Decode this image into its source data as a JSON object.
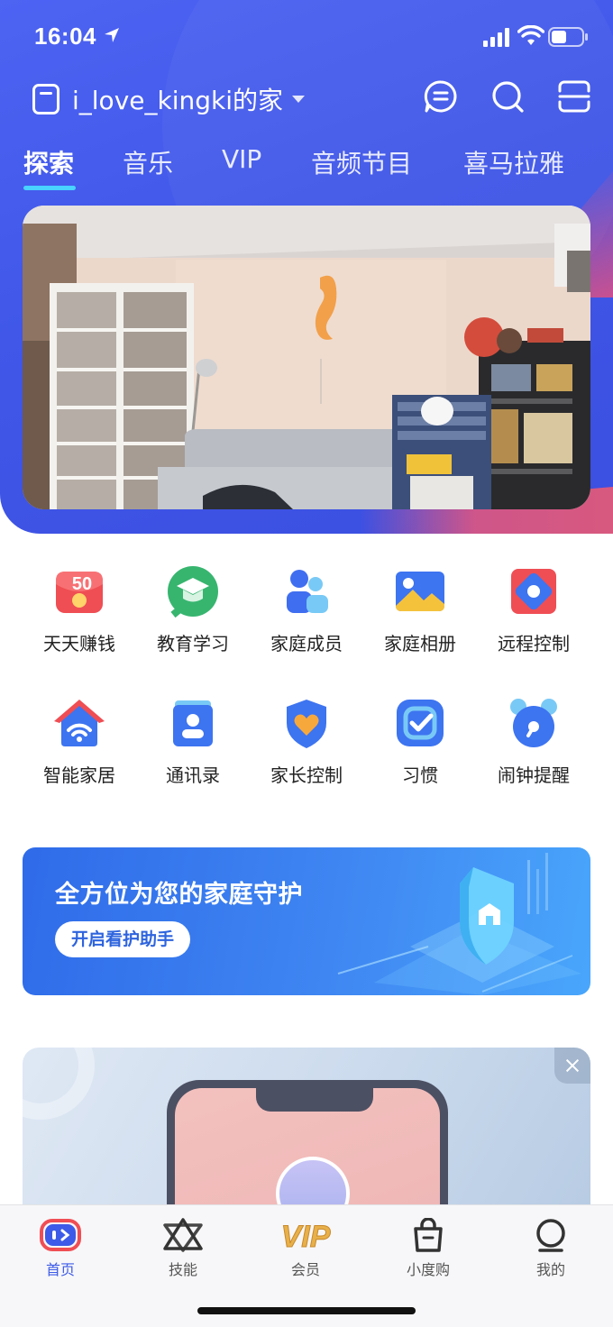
{
  "status_bar": {
    "time": "16:04"
  },
  "header": {
    "home_name": "i_love_kingki的家",
    "icons": [
      "chat-icon",
      "search-icon",
      "scan-icon"
    ]
  },
  "tabs": [
    {
      "label": "探索",
      "active": true
    },
    {
      "label": "音乐",
      "active": false
    },
    {
      "label": "VIP",
      "active": false
    },
    {
      "label": "音频节目",
      "active": false
    },
    {
      "label": "喜马拉雅",
      "active": false
    }
  ],
  "shortcuts": [
    {
      "label": "天天赚钱",
      "icon": "red-envelope-icon",
      "badge": "50"
    },
    {
      "label": "教育学习",
      "icon": "graduation-cap-icon"
    },
    {
      "label": "家庭成员",
      "icon": "family-members-icon"
    },
    {
      "label": "家庭相册",
      "icon": "photo-album-icon"
    },
    {
      "label": "远程控制",
      "icon": "remote-control-icon"
    },
    {
      "label": "智能家居",
      "icon": "smart-home-icon"
    },
    {
      "label": "通讯录",
      "icon": "contacts-icon"
    },
    {
      "label": "家长控制",
      "icon": "parental-control-icon"
    },
    {
      "label": "习惯",
      "icon": "habit-check-icon"
    },
    {
      "label": "闹钟提醒",
      "icon": "alarm-clock-icon"
    }
  ],
  "guard_banner": {
    "title": "全方位为您的家庭守护",
    "button": "开启看护助手"
  },
  "bottom_nav": [
    {
      "label": "首页",
      "icon": "home-tv-icon",
      "active": true
    },
    {
      "label": "技能",
      "icon": "skills-icon",
      "active": false
    },
    {
      "label": "会员",
      "icon": "vip-icon",
      "active": false
    },
    {
      "label": "小度购",
      "icon": "shopping-bag-icon",
      "active": false
    },
    {
      "label": "我的",
      "icon": "profile-icon",
      "active": false
    }
  ],
  "colors": {
    "header_blue": "#4057e8",
    "tab_indicator": "#49d3ff",
    "nav_active": "#3d5be8",
    "vip_gold": "#e8b04a"
  }
}
